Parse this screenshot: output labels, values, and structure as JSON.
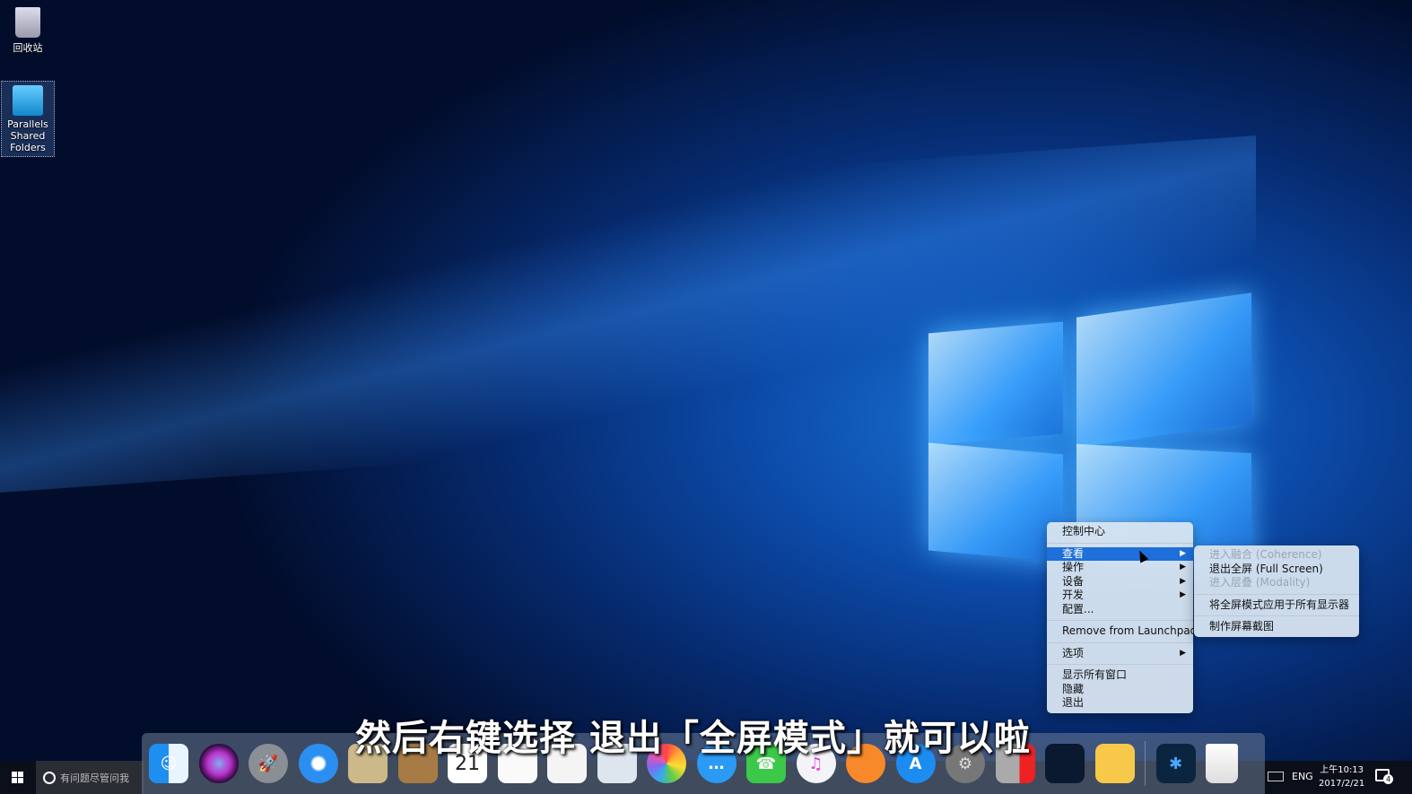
{
  "desktop": {
    "icons": [
      {
        "label": "回收站"
      },
      {
        "label": "Parallels Shared Folders"
      }
    ]
  },
  "context_menu": {
    "items": [
      {
        "label": "控制中心"
      },
      {
        "label": "查看",
        "submenu": true
      },
      {
        "label": "操作",
        "submenu": true
      },
      {
        "label": "设备",
        "submenu": true
      },
      {
        "label": "开发",
        "submenu": true
      },
      {
        "label": "配置..."
      },
      {
        "label": "Remove from Launchpad"
      },
      {
        "label": "选项",
        "submenu": true
      },
      {
        "label": "显示所有窗口"
      },
      {
        "label": "隐藏"
      },
      {
        "label": "退出"
      }
    ],
    "arrow": "▶"
  },
  "submenu": {
    "items": [
      {
        "label": "进入融合 (Coherence)",
        "disabled": true
      },
      {
        "label": "退出全屏 (Full Screen)"
      },
      {
        "label": "进入层叠 (Modality)",
        "disabled": true
      },
      {
        "label": "将全屏模式应用于所有显示器"
      },
      {
        "label": "制作屏幕截图"
      }
    ]
  },
  "subtitle": "然后右键选择 退出「全屏模式」就可以啦",
  "taskbar": {
    "search_placeholder": "有问题尽管问我",
    "lang": "ENG",
    "time": "上午10:13",
    "date": "2017/2/21",
    "notification_count": "4"
  },
  "dock": {
    "calendar_day": "21",
    "apps": [
      "finder",
      "siri",
      "launchpad",
      "safari",
      "mail",
      "contacts",
      "calendar",
      "notes",
      "reminders",
      "preview",
      "photos",
      "messages",
      "facetime",
      "itunes",
      "ibooks",
      "app-store",
      "system-preferences",
      "parallels-desktop",
      "windows-vm",
      "folder",
      "battle-net",
      "trash"
    ]
  }
}
